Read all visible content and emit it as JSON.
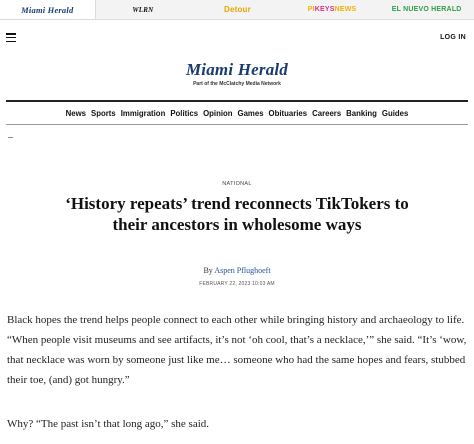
{
  "network_bar": {
    "tabs": [
      {
        "label": "Miami Herald"
      },
      {
        "label": "WLRN"
      },
      {
        "label": "Detour"
      },
      {
        "label_prefix": "PI",
        "label_highlight": "KEYS",
        "label_suffix": "NEWS"
      },
      {
        "label": "EL NUEVO HERALD"
      }
    ]
  },
  "header": {
    "login_label": "LOG IN",
    "logo_text": "Miami Herald",
    "tagline": "Part of the McClatchy Media Network"
  },
  "nav": {
    "items": [
      "News",
      "Sports",
      "Immigration",
      "Politics",
      "Opinion",
      "Games",
      "Obituaries",
      "Careers",
      "Banking",
      "Guides"
    ]
  },
  "article": {
    "kicker": "NATIONAL",
    "headline": "‘History repeats’ trend reconnects TikTokers to their ancestors in wholesome ways",
    "byline_prefix": "By",
    "author": "Aspen Pflughoeft",
    "date": "FEBRUARY 22, 2023 10:03 AM",
    "paragraphs": [
      "Black hopes the trend helps people connect to each other while bringing history and archaeology to life. “When people visit museums and see artifacts, it’s not ‘oh cool, that’s a necklace,’” she said. “It’s ‘wow, that necklace was worn by someone just like me… someone who had the same hopes and fears, stubbed their toe, (and) got hungry.”",
      "Why? “The past isn’t that long ago,” she said."
    ]
  },
  "colors": {
    "brand_blue": "#1a3b6e",
    "link_blue": "#1f4f9c",
    "detour_yellow": "#e8a400",
    "elnuevo_green": "#2e9e46"
  }
}
